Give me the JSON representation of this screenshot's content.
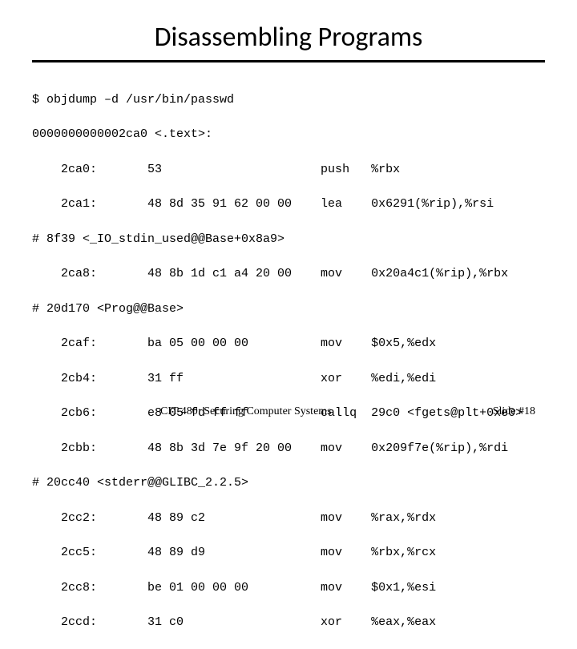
{
  "title": "Disassembling Programs",
  "footer": {
    "left": "CIT 480: Securing Computer Systems",
    "right": "Slide #18"
  },
  "code_lines": [
    "$ objdump –d /usr/bin/passwd",
    "0000000000002ca0 <.text>:",
    "    2ca0:       53                      push   %rbx",
    "    2ca1:       48 8d 35 91 62 00 00    lea    0x6291(%rip),%rsi",
    "# 8f39 <_IO_stdin_used@@Base+0x8a9>",
    "    2ca8:       48 8b 1d c1 a4 20 00    mov    0x20a4c1(%rip),%rbx",
    "# 20d170 <Prog@@Base>",
    "    2caf:       ba 05 00 00 00          mov    $0x5,%edx",
    "    2cb4:       31 ff                   xor    %edi,%edi",
    "    2cb6:       e8 05 fd ff ff          callq  29c0 <fgets@plt+0xe0>",
    "    2cbb:       48 8b 3d 7e 9f 20 00    mov    0x209f7e(%rip),%rdi",
    "# 20cc40 <stderr@@GLIBC_2.2.5>",
    "    2cc2:       48 89 c2                mov    %rax,%rdx",
    "    2cc5:       48 89 d9                mov    %rbx,%rcx",
    "    2cc8:       be 01 00 00 00          mov    $0x1,%esi",
    "    2ccd:       31 c0                   xor    %eax,%eax"
  ]
}
